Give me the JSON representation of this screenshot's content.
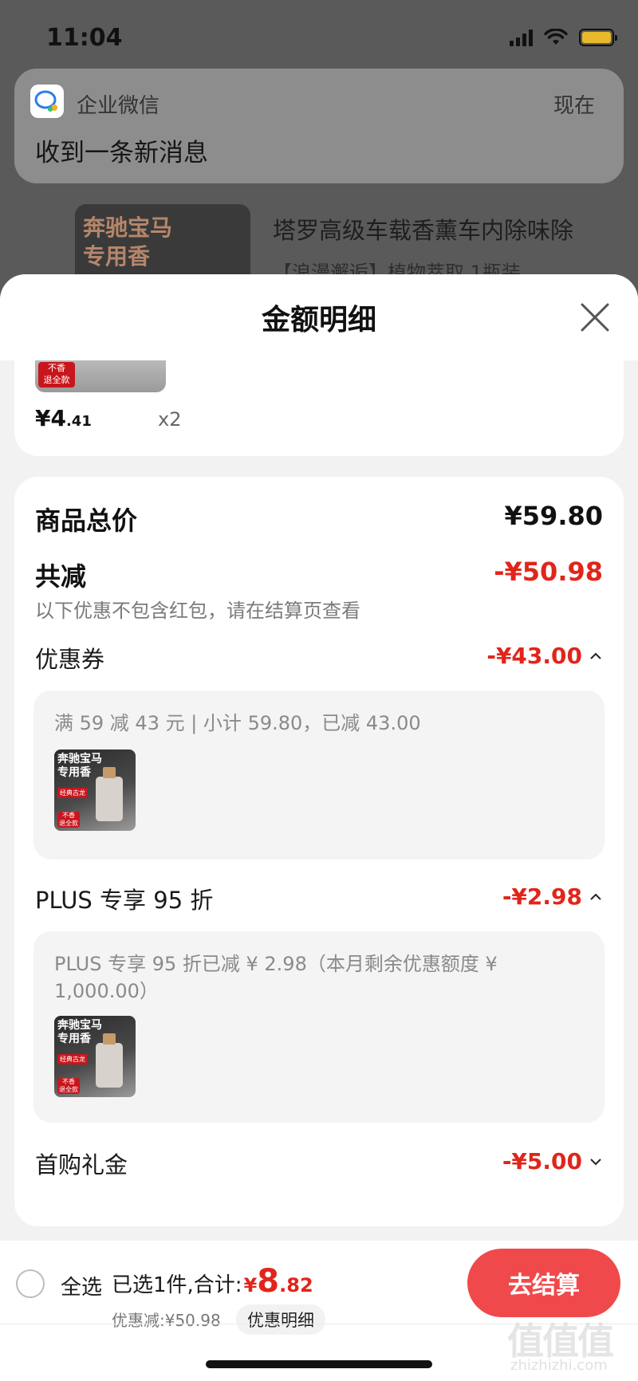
{
  "status_bar": {
    "time": "11:04"
  },
  "notification": {
    "app_name": "企业微信",
    "time": "现在",
    "message": "收到一条新消息"
  },
  "background_product": {
    "image_text": [
      "奔驰宝马",
      "专用香"
    ],
    "title": "塔罗高级车载香薰车内除味除",
    "spec": "【浪漫邂逅】植物萃取 1瓶装 ⌄"
  },
  "sheet": {
    "title": "金额明细",
    "item": {
      "image_tag": "不香\n退全款",
      "price_int": "¥4",
      "price_dec": ".41",
      "qty": "x2"
    },
    "summary": {
      "total_label": "商品总价",
      "total_value": "¥59.80",
      "reduce_label": "共减",
      "reduce_value": "-¥50.98",
      "note": "以下优惠不包含红包，请在结算页查看"
    },
    "coupon": {
      "label": "优惠券",
      "value": "-¥43.00",
      "detail": "满 59 减 43 元 | 小计 59.80，已减 43.00"
    },
    "plus": {
      "label": "PLUS 专享 95 折",
      "value": "-¥2.98",
      "detail": "PLUS 专享 95 折已减 ¥ 2.98（本月剩余优惠额度 ¥ 1,000.00）"
    },
    "gift": {
      "label": "首购礼金",
      "value": "-¥5.00"
    },
    "thumb": {
      "line1": "奔驰宝马",
      "line2": "专用香",
      "tag1": "经典古龙",
      "tag2": "不香\n退全款"
    }
  },
  "bottom_bar": {
    "select_all": "全选",
    "selected_prefix": "已选1件,合计:",
    "total_currency": "¥",
    "total_int": "8",
    "total_dec": ".82",
    "discount": "优惠减:¥50.98",
    "detail_chip": "优惠明细",
    "checkout": "去结算"
  },
  "watermark": {
    "glyphs": "值值值",
    "url": "zhizhizhi.com"
  },
  "colors": {
    "accent_red": "#e1251b",
    "checkout_red": "#f0494c"
  }
}
